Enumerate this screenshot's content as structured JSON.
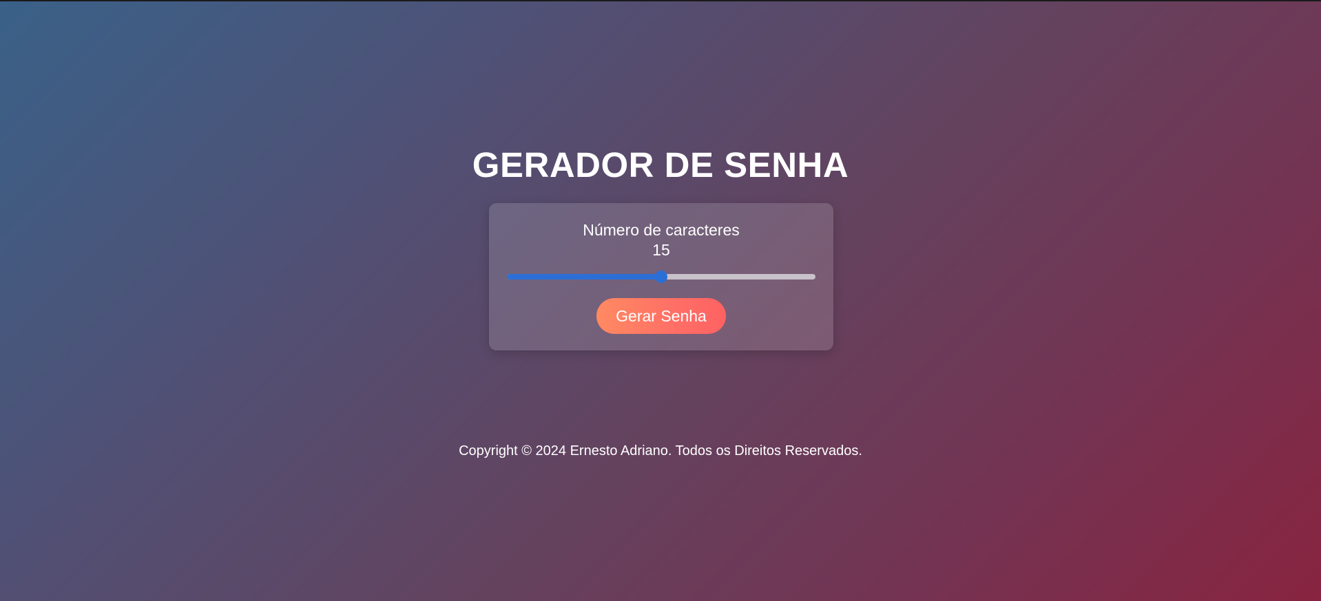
{
  "title": "GERADOR DE SENHA",
  "generator": {
    "length_label": "Número de caracteres",
    "length_value": "15",
    "slider": {
      "value": 15,
      "min": 1,
      "max": 29
    },
    "generate_button_label": "Gerar Senha"
  },
  "footer": {
    "copyright": "Copyright © 2024 Ernesto Adriano. Todos os Direitos Reservados."
  },
  "colors": {
    "slider_accent": "#2b6fd6",
    "button_gradient_start": "#ff8a62",
    "button_gradient_end": "#fe6262"
  }
}
